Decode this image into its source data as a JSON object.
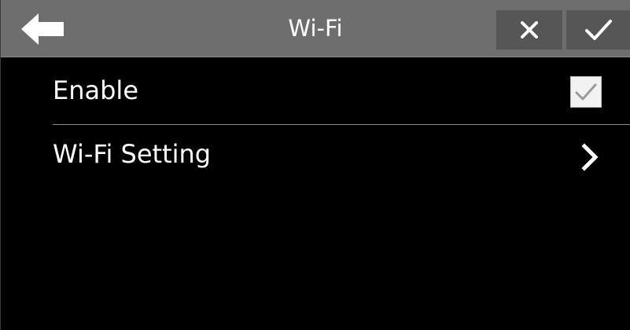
{
  "header": {
    "title": "Wi-Fi",
    "back_icon": "arrow-left-icon",
    "cancel_icon": "close-icon",
    "ok_icon": "checkmark-icon"
  },
  "settings": {
    "enable": {
      "label": "Enable",
      "checked": true
    },
    "wifi_setting": {
      "label": "Wi-Fi Setting",
      "icon": "chevron-right-icon"
    }
  },
  "colors": {
    "header_bg": "#6e6e6e",
    "header_button_bg": "#565656",
    "screen_bg": "#000000",
    "text": "#ffffff",
    "divider": "#8a8a8a",
    "checkbox_bg": "#f2f2f2",
    "checkmark": "#9a9a9a"
  }
}
